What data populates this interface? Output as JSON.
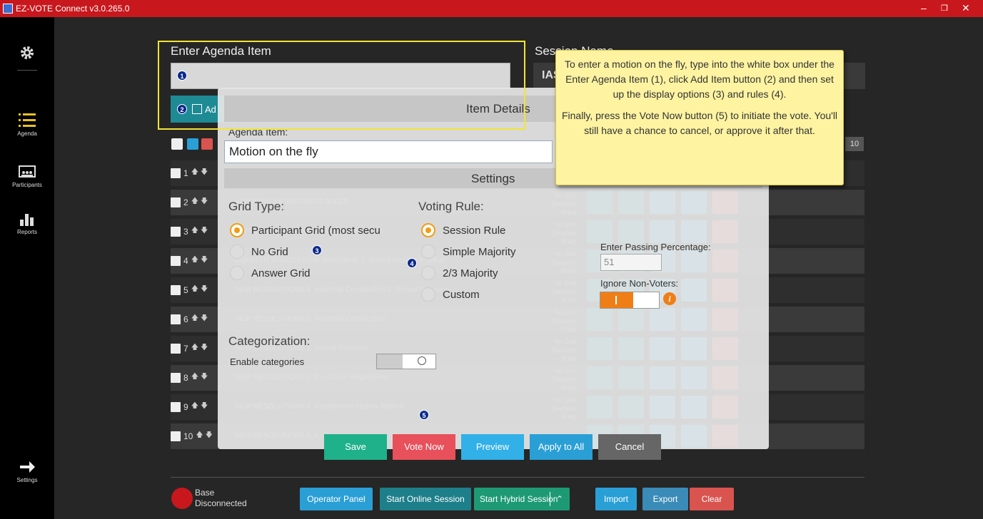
{
  "window": {
    "title": "EZ-VOTE Connect v3.0.265.0"
  },
  "sidebar": {
    "items": [
      {
        "label": "",
        "icon": "gear-icon"
      },
      {
        "label": "Agenda",
        "icon": "list-icon"
      },
      {
        "label": "Participants",
        "icon": "participants-icon"
      },
      {
        "label": "Reports",
        "icon": "bar-chart-icon"
      },
      {
        "label": "Settings",
        "icon": "arrow-right-icon"
      }
    ]
  },
  "agenda_entry": {
    "label": "Enter Agenda Item",
    "value": "",
    "add_button": "Ad"
  },
  "session": {
    "label": "Session Name",
    "value": "IAS"
  },
  "list_count": "10",
  "rows": [
    {
      "num": "1",
      "text": "",
      "grid": "",
      "rule": ""
    },
    {
      "num": "2",
      "text": "APPROVAL OF BUSINESS RULES",
      "grid": "No Grid",
      "rule": "[Session Rule]"
    },
    {
      "num": "3",
      "text": "APPROVAL OF AGENDA FOR AUGUST 2023",
      "grid": "No Grid",
      "rule": "[Session Rule]"
    },
    {
      "num": "4",
      "text": "CONSENT AGENDA NEW Resolutions 1. School Resource Officer",
      "grid": "No Grid",
      "rule": "[Session Rule]"
    },
    {
      "num": "5",
      "text": "NEW RESOLUTIONS 1. Industrial Construction 2. School Resource",
      "grid": "No Grid",
      "rule": "[Session Rule]"
    },
    {
      "num": "6",
      "text": "NEW RESOLUTIONS 1. Industrial Construction",
      "grid": "No Grid",
      "rule": "[Session Rule]"
    },
    {
      "num": "7",
      "text": "NEW RESOLUTIONS 2. School Resource",
      "grid": "No Grid",
      "rule": "[Session Rule]"
    },
    {
      "num": "8",
      "text": "NEW RESOLUTIONS 3. Bus Driver Regulations",
      "grid": "No Grid",
      "rule": "[Session Rule]"
    },
    {
      "num": "9",
      "text": "NEW RESOLUTIONS 4. Employment History Review",
      "grid": "No Grid",
      "rule": "[Session Rule]"
    },
    {
      "num": "10",
      "text": "NEW RESOLUTIONS 5. A",
      "grid": "",
      "rule": ""
    }
  ],
  "status": {
    "line1": "Base",
    "line2": "Disconnected"
  },
  "bottom_buttons": {
    "operator": "Operator Panel",
    "online": "Start Online Session",
    "hybrid": "Start Hybrid Session",
    "import": "Import",
    "export": "Export",
    "clear": "Clear"
  },
  "modal": {
    "title": "Item Details",
    "agenda_label": "Agenda Item:",
    "agenda_value": "Motion on the fly",
    "settings_title": "Settings",
    "grid_type_label": "Grid Type:",
    "grid_options": [
      "Participant Grid (most secu",
      "No Grid",
      "Answer Grid"
    ],
    "grid_selected": "Participant Grid (most secu",
    "voting_rule_label": "Voting Rule:",
    "rule_options": [
      "Session Rule",
      "Simple Majority",
      "2/3 Majority",
      "Custom"
    ],
    "rule_selected": "Session Rule",
    "passing_label": "Enter Passing Percentage:",
    "passing_value": "51",
    "ignore_label": "Ignore Non-Voters:",
    "ignore_enabled": true,
    "categorization_label": "Categorization:",
    "enable_categories_label": "Enable categories",
    "categories_enabled": false,
    "buttons": {
      "save": "Save",
      "vote_now": "Vote Now",
      "preview": "Preview",
      "apply_all": "Apply to All",
      "cancel": "Cancel"
    }
  },
  "callouts": [
    "1",
    "2",
    "3",
    "4",
    "5"
  ],
  "tooltip": {
    "p1": "To enter a motion on the fly, type into the white box under the Enter Agenda Item (1), click Add Item button (2) and then set up the display options (3) and rules (4).",
    "p2": "Finally, press the Vote Now button (5) to initiate the vote. You'll still have a chance to cancel, or approve it after that."
  },
  "colors": {
    "titlebar": "#c8181d",
    "teal": "#1d8a94",
    "orange": "#f07e16",
    "red": "#d9534f",
    "blue": "#2a9fd6"
  }
}
